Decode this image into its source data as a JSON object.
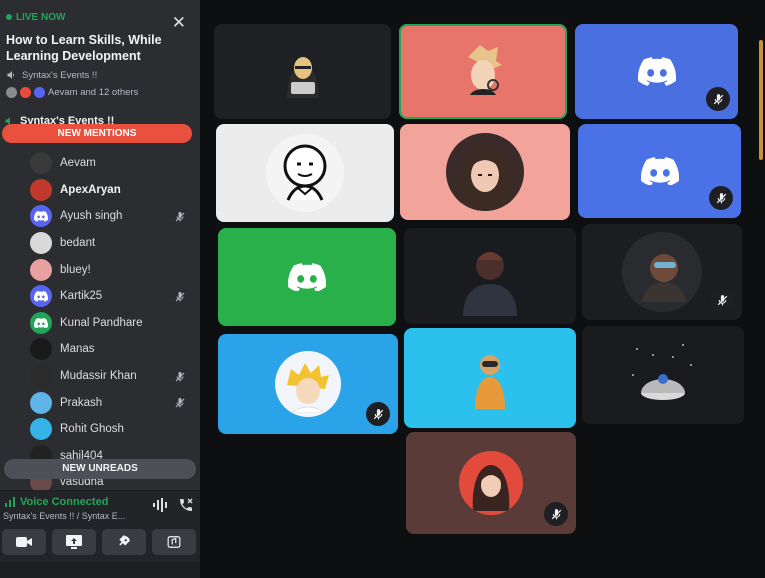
{
  "live": {
    "label": "LIVE NOW",
    "title": "How to Learn Skills, While Learning Development",
    "server": "Syntax's Events !!",
    "others": "Aevam and 12 others"
  },
  "channel": {
    "name": "Syntax's Events !!"
  },
  "badges": {
    "mentions": "NEW MENTIONS",
    "unreads": "NEW UNREADS"
  },
  "members": [
    {
      "name": "Aevam",
      "muted": false,
      "bold": false,
      "color": "#3a3a3a"
    },
    {
      "name": "ApexAryan",
      "muted": false,
      "bold": true,
      "color": "#c0392b"
    },
    {
      "name": "Ayush singh",
      "muted": true,
      "bold": false,
      "color": "#5865f2"
    },
    {
      "name": "bedant",
      "muted": false,
      "bold": false,
      "color": "#d9d9d9"
    },
    {
      "name": "bluey!",
      "muted": false,
      "bold": false,
      "color": "#e8a0a0"
    },
    {
      "name": "Kartik25",
      "muted": true,
      "bold": false,
      "color": "#5865f2"
    },
    {
      "name": "Kunal Pandhare",
      "muted": false,
      "bold": false,
      "color": "#23a559"
    },
    {
      "name": "Manas",
      "muted": false,
      "bold": false,
      "color": "#1a1a1a"
    },
    {
      "name": "Mudassir Khan",
      "muted": true,
      "bold": false,
      "color": "#2b2b2b"
    },
    {
      "name": "Prakash",
      "muted": true,
      "bold": false,
      "color": "#5fb4e8"
    },
    {
      "name": "Rohit Ghosh",
      "muted": false,
      "bold": false,
      "color": "#36b3e8"
    },
    {
      "name": "sahil404",
      "muted": false,
      "bold": false,
      "color": "#222222"
    },
    {
      "name": "vasudha",
      "muted": false,
      "bold": false,
      "color": "#6b4a4a"
    }
  ],
  "voice": {
    "status": "Voice Connected",
    "location": "Syntax's Events !! / Syntax E..."
  },
  "tiles": [
    {
      "id": "hacker",
      "bg": "#1f2023",
      "avatar": "hacker",
      "muted": false
    },
    {
      "id": "anime-boy",
      "bg": "#e8756a",
      "avatar": "anime",
      "muted": false,
      "speaking": true
    },
    {
      "id": "discord-blue-1",
      "bg": "#4a6fe0",
      "avatar": "discord",
      "muted": true
    },
    {
      "id": "meme",
      "bg": "#ececec",
      "avatar": "meme",
      "muted": false
    },
    {
      "id": "anime-girl",
      "bg": "#f2a39a",
      "avatar": "girl",
      "muted": false
    },
    {
      "id": "discord-blue-2",
      "bg": "#4a72e6",
      "avatar": "discord",
      "muted": true
    },
    {
      "id": "discord-green",
      "bg": "#2ab04a",
      "avatar": "discord",
      "muted": false
    },
    {
      "id": "hoodie",
      "bg": "#1a1b1e",
      "avatar": "hoodie",
      "muted": false
    },
    {
      "id": "dark-pic",
      "bg": "#1c1d20",
      "avatar": "dark",
      "muted": true
    },
    {
      "id": "naruto",
      "bg": "#2aa3e8",
      "avatar": "naruto",
      "muted": true
    },
    {
      "id": "astro",
      "bg": "#2cc0ec",
      "avatar": "astro",
      "muted": false
    },
    {
      "id": "space",
      "bg": "#1a1b1e",
      "avatar": "space",
      "muted": false
    },
    {
      "id": "red-girl",
      "bg": "#5a3b38",
      "avatar": "redgirl",
      "muted": true
    }
  ]
}
